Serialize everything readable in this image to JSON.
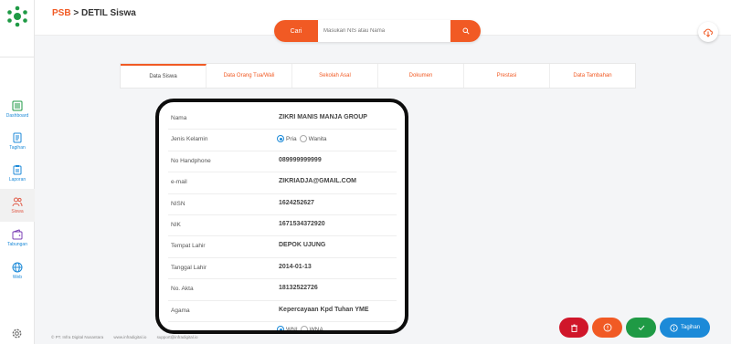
{
  "header": {
    "crumb_root": "PSB",
    "crumb_sep": " > ",
    "crumb_page": "DETIL Siswa"
  },
  "search": {
    "button_label": "Cari",
    "placeholder": "Masukan NIS atau Nama"
  },
  "sidebar": {
    "items": [
      {
        "label": "Dashboard",
        "icon": "dashboard-icon"
      },
      {
        "label": "Tagihan",
        "icon": "invoice-icon"
      },
      {
        "label": "Laporan",
        "icon": "clipboard-icon"
      },
      {
        "label": "Siswa",
        "icon": "users-icon",
        "active": true
      },
      {
        "label": "Tabungan",
        "icon": "wallet-icon"
      },
      {
        "label": "Web",
        "icon": "globe-icon"
      }
    ]
  },
  "tabs": [
    "Data Siswa",
    "Data Orang Tua/Wali",
    "Sekolah Asal",
    "Dokumen",
    "Prestasi",
    "Data Tambahan"
  ],
  "detail": {
    "nama": {
      "label": "Nama",
      "value": "ZIKRI MANIS MANJA GROUP"
    },
    "jk": {
      "label": "Jenis Kelamin",
      "options": [
        "Pria",
        "Wanita"
      ],
      "selected": "Pria"
    },
    "hp": {
      "label": "No Handphone",
      "value": "089999999999"
    },
    "email": {
      "label": "e-mail",
      "value": "ZIKRIADJA@GMAIL.COM"
    },
    "nisn": {
      "label": "NISN",
      "value": "1624252627"
    },
    "nik": {
      "label": "NIK",
      "value": "1671534372920"
    },
    "tempat": {
      "label": "Tempat Lahir",
      "value": "DEPOK UJUNG"
    },
    "tanggal": {
      "label": "Tanggal Lahir",
      "value": "2014-01-13"
    },
    "akta": {
      "label": "No. Akta",
      "value": "18132522726"
    },
    "agama": {
      "label": "Agama",
      "value": "Kepercayaan Kpd Tuhan YME"
    },
    "wn": {
      "options": [
        "WNI",
        "WNA"
      ],
      "selected": "WNI"
    }
  },
  "footer": {
    "copyright": "© PT. Infra Digital Nusantara",
    "website": "www.infradigital.io",
    "email": "support@infradigital.io"
  },
  "actions": {
    "bill_label": "Tagihan"
  },
  "colors": {
    "accent": "#f15a24",
    "primary": "#1c8ad8",
    "danger": "#d0162a",
    "success": "#1f9a45"
  }
}
